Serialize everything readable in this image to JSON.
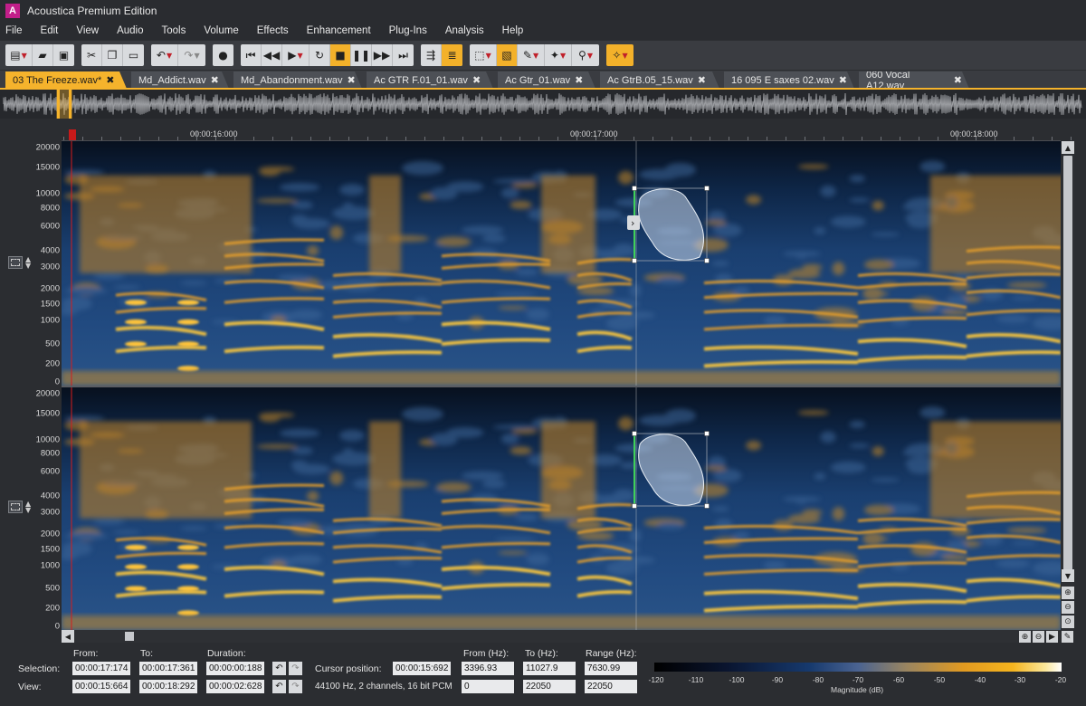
{
  "app": {
    "title": "Acoustica Premium Edition"
  },
  "menu": [
    "File",
    "Edit",
    "View",
    "Audio",
    "Tools",
    "Volume",
    "Effects",
    "Enhancement",
    "Plug-Ins",
    "Analysis",
    "Help"
  ],
  "tabs": [
    {
      "label": "03 The Freeze.wav*",
      "active": true
    },
    {
      "label": "Md_Addict.wav",
      "active": false
    },
    {
      "label": "Md_Abandonment.wav",
      "active": false
    },
    {
      "label": "Ac GTR F.01_01.wav",
      "active": false
    },
    {
      "label": "Ac Gtr_01.wav",
      "active": false
    },
    {
      "label": "Ac GtrB.05_15.wav",
      "active": false
    },
    {
      "label": "16 095 E saxes 02.wav",
      "active": false
    },
    {
      "label": "060 Vocal A12.wav",
      "active": false
    }
  ],
  "ruler": {
    "labels": [
      "00:00:16:000",
      "00:00:17:000",
      "00:00:18:000"
    ]
  },
  "freq_labels": [
    "20000",
    "15000",
    "10000",
    "8000",
    "6000",
    "4000",
    "3000",
    "2000",
    "1500",
    "1000",
    "500",
    "200",
    "0"
  ],
  "colors": {
    "accent": "#f5b32c",
    "background": "#2b2d31",
    "selection_edge": "#3fd15a",
    "cursor": "#d81b1b"
  },
  "status": {
    "col_from": "From:",
    "col_to": "To:",
    "col_duration": "Duration:",
    "selection_label": "Selection:",
    "view_label": "View:",
    "sel_from": "00:00:17:174",
    "sel_to": "00:00:17:361",
    "sel_duration": "00:00:00:188",
    "view_from": "00:00:15:664",
    "view_to": "00:00:18:292",
    "view_duration": "00:00:02:628",
    "cursor_label": "Cursor position:",
    "cursor_value": "00:00:15:692",
    "format_info": "44100 Hz, 2 channels, 16 bit PCM",
    "from_hz_label": "From (Hz):",
    "to_hz_label": "To (Hz):",
    "range_hz_label": "Range (Hz):",
    "from_hz": "3396.93",
    "to_hz": "11027.9",
    "range_hz": "7630.99",
    "view_from_hz": "0",
    "view_to_hz": "22050",
    "view_range_hz": "22050"
  },
  "colorbar": {
    "ticks": [
      "-120",
      "-110",
      "-100",
      "-90",
      "-80",
      "-70",
      "-60",
      "-50",
      "-40",
      "-30",
      "-20"
    ],
    "title": "Magnitude (dB)"
  }
}
